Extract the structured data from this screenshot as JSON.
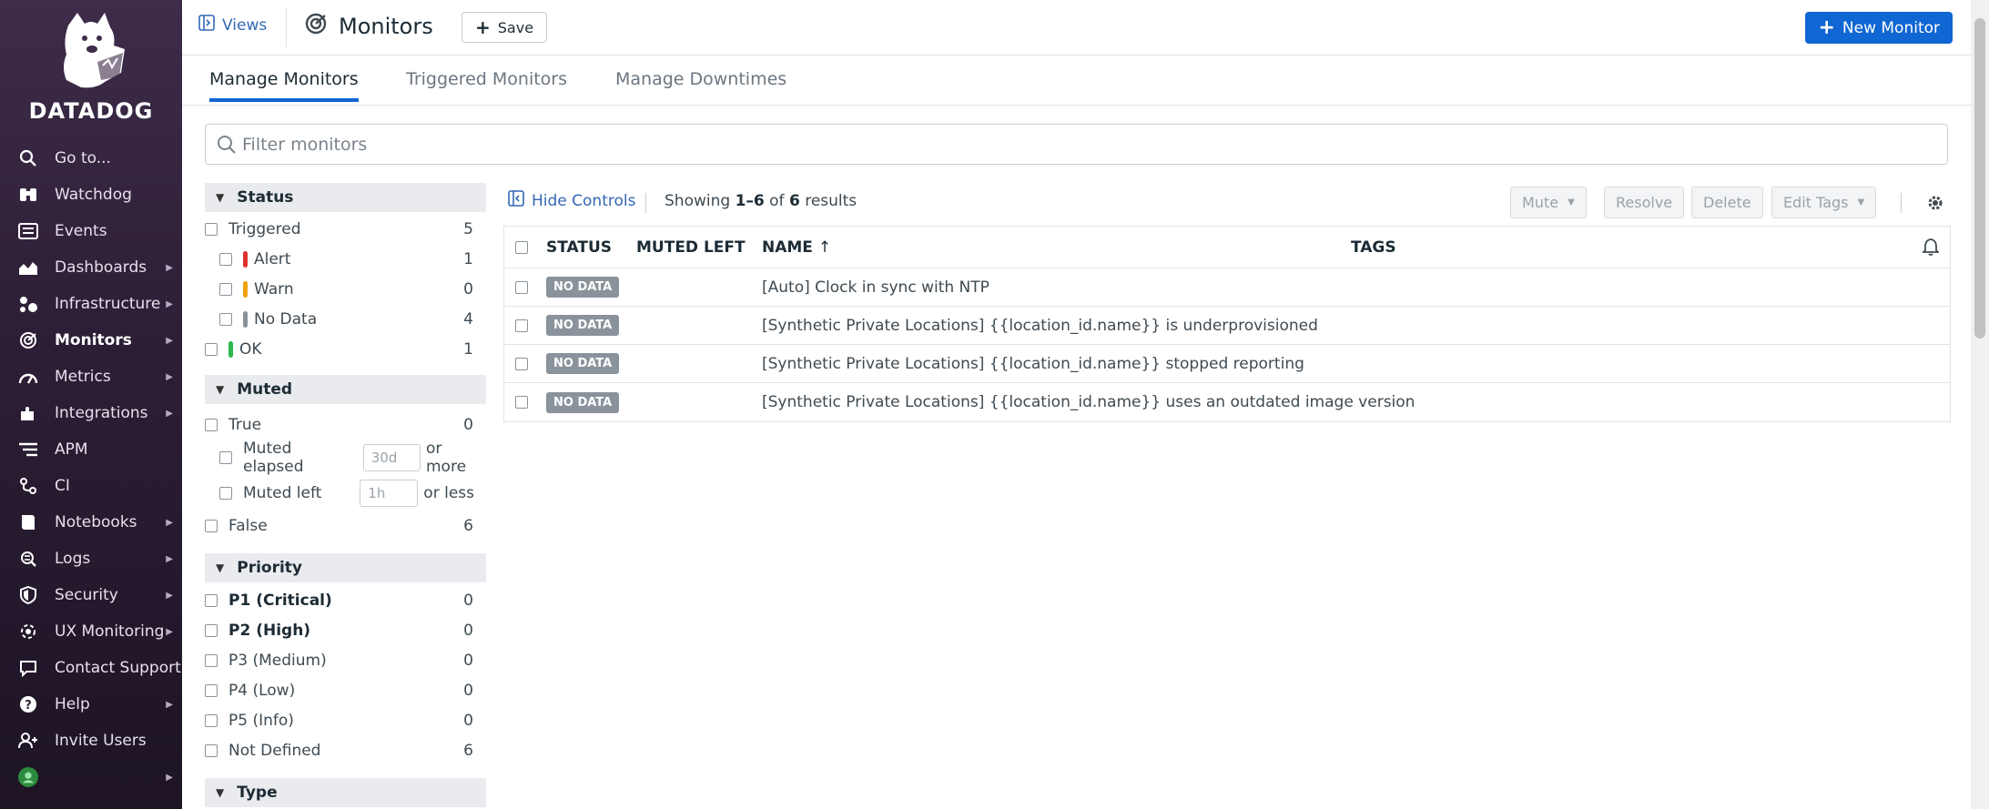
{
  "brand": {
    "name": "DATADOG"
  },
  "sidebar": {
    "items": [
      {
        "label": "Go to...",
        "icon": "search-icon",
        "caret": false,
        "active": false
      },
      {
        "label": "Watchdog",
        "icon": "binoculars-icon",
        "caret": false,
        "active": false
      },
      {
        "label": "Events",
        "icon": "events-icon",
        "caret": false,
        "active": false
      },
      {
        "label": "Dashboards",
        "icon": "chart-icon",
        "caret": true,
        "active": false
      },
      {
        "label": "Infrastructure",
        "icon": "infrastructure-icon",
        "caret": true,
        "active": false
      },
      {
        "label": "Monitors",
        "icon": "monitor-icon",
        "caret": true,
        "active": true
      },
      {
        "label": "Metrics",
        "icon": "gauge-icon",
        "caret": true,
        "active": false
      },
      {
        "label": "Integrations",
        "icon": "puzzle-icon",
        "caret": true,
        "active": false
      },
      {
        "label": "APM",
        "icon": "apm-icon",
        "caret": true,
        "active": false
      },
      {
        "label": "CI",
        "icon": "ci-icon",
        "caret": false,
        "active": false
      },
      {
        "label": "Notebooks",
        "icon": "notebook-icon",
        "caret": true,
        "active": false
      },
      {
        "label": "Logs",
        "icon": "logs-icon",
        "caret": true,
        "active": false
      },
      {
        "label": "Security",
        "icon": "shield-icon",
        "caret": true,
        "active": false
      },
      {
        "label": "UX Monitoring",
        "icon": "ux-icon",
        "caret": true,
        "active": false
      },
      {
        "label": "Contact Support",
        "icon": "chat-icon",
        "caret": false,
        "active": false
      },
      {
        "label": "Help",
        "icon": "help-icon",
        "caret": true,
        "active": false
      },
      {
        "label": "Invite Users",
        "icon": "users-icon",
        "caret": false,
        "active": false
      }
    ]
  },
  "header": {
    "views_label": "Views",
    "title": "Monitors",
    "save_label": "Save",
    "new_monitor_label": "New Monitor"
  },
  "tabs": [
    {
      "label": "Manage Monitors",
      "active": true
    },
    {
      "label": "Triggered Monitors",
      "active": false
    },
    {
      "label": "Manage Downtimes",
      "active": false
    }
  ],
  "filter": {
    "placeholder": "Filter monitors"
  },
  "facets": {
    "status": {
      "title": "Status",
      "triggered": {
        "label": "Triggered",
        "count": "5"
      },
      "alert": {
        "label": "Alert",
        "count": "1",
        "color": "#e0322f"
      },
      "warn": {
        "label": "Warn",
        "count": "0",
        "color": "#f0a20a"
      },
      "nodata": {
        "label": "No Data",
        "count": "4",
        "color": "#8a939b"
      },
      "ok": {
        "label": "OK",
        "count": "1",
        "color": "#2db851"
      }
    },
    "muted": {
      "title": "Muted",
      "true": {
        "label": "True",
        "count": "0"
      },
      "elapsed": {
        "label": "Muted elapsed",
        "placeholder": "30d",
        "suffix": "or more"
      },
      "left": {
        "label": "Muted left",
        "placeholder": "1h",
        "suffix": "or less"
      },
      "false": {
        "label": "False",
        "count": "6"
      }
    },
    "priority": {
      "title": "Priority",
      "items": [
        {
          "label": "P1 (Critical)",
          "count": "0"
        },
        {
          "label": "P2 (High)",
          "count": "0"
        },
        {
          "label": "P3 (Medium)",
          "count": "0"
        },
        {
          "label": "P4 (Low)",
          "count": "0"
        },
        {
          "label": "P5 (Info)",
          "count": "0"
        },
        {
          "label": "Not Defined",
          "count": "6"
        }
      ]
    },
    "type": {
      "title": "Type"
    }
  },
  "controls": {
    "hide_label": "Hide Controls",
    "showing_prefix": "Showing",
    "showing_range": "1–6",
    "showing_of": "of",
    "showing_total": "6",
    "showing_suffix": "results",
    "mute_label": "Mute",
    "resolve_label": "Resolve",
    "delete_label": "Delete",
    "edit_tags_label": "Edit Tags"
  },
  "table": {
    "columns": {
      "status": "STATUS",
      "muted_left": "MUTED LEFT",
      "name": "NAME",
      "tags": "TAGS"
    },
    "rows": [
      {
        "status": "NO DATA",
        "name": "[Auto] Clock in sync with NTP"
      },
      {
        "status": "NO DATA",
        "name": "[Synthetic Private Locations] {{location_id.name}} is underprovisioned"
      },
      {
        "status": "NO DATA",
        "name": "[Synthetic Private Locations] {{location_id.name}} stopped reporting"
      },
      {
        "status": "NO DATA",
        "name": "[Synthetic Private Locations] {{location_id.name}} uses an outdated image version"
      }
    ]
  }
}
